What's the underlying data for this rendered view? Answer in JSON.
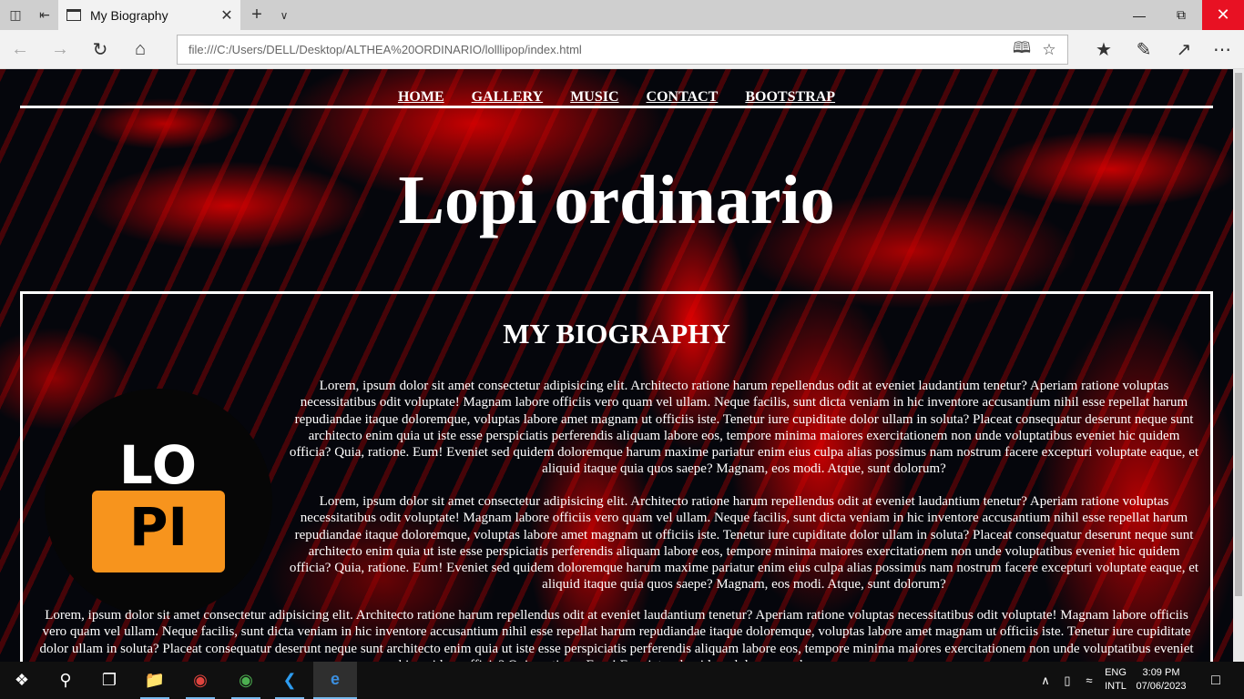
{
  "browser": {
    "tab_title": "My Biography",
    "url": "file:///C:/Users/DELL/Desktop/ALTHEA%20ORDINARIO/lolllipop/index.html"
  },
  "site": {
    "nav": [
      "HOME",
      "GALLERY",
      "MUSIC",
      "CONTACT",
      "BOOTSTRAP"
    ],
    "title": "Lopi ordinario",
    "bio_heading": "MY BIOGRAPHY",
    "logo_top": "LO",
    "logo_bottom": "PI",
    "paragraphs": [
      "Lorem, ipsum dolor sit amet consectetur adipisicing elit. Architecto ratione harum repellendus odit at eveniet laudantium tenetur? Aperiam ratione voluptas necessitatibus odit voluptate! Magnam labore officiis vero quam vel ullam. Neque facilis, sunt dicta veniam in hic inventore accusantium nihil esse repellat harum repudiandae itaque doloremque, voluptas labore amet magnam ut officiis iste. Tenetur iure cupiditate dolor ullam in soluta? Placeat consequatur deserunt neque sunt architecto enim quia ut iste esse perspiciatis perferendis aliquam labore eos, tempore minima maiores exercitationem non unde voluptatibus eveniet hic quidem officia? Quia, ratione. Eum! Eveniet sed quidem doloremque harum maxime pariatur enim eius culpa alias possimus nam nostrum facere excepturi voluptate eaque, et aliquid itaque quia quos saepe? Magnam, eos modi. Atque, sunt dolorum?",
      "Lorem, ipsum dolor sit amet consectetur adipisicing elit. Architecto ratione harum repellendus odit at eveniet laudantium tenetur? Aperiam ratione voluptas necessitatibus odit voluptate! Magnam labore officiis vero quam vel ullam. Neque facilis, sunt dicta veniam in hic inventore accusantium nihil esse repellat harum repudiandae itaque doloremque, voluptas labore amet magnam ut officiis iste. Tenetur iure cupiditate dolor ullam in soluta? Placeat consequatur deserunt neque sunt architecto enim quia ut iste esse perspiciatis perferendis aliquam labore eos, tempore minima maiores exercitationem non unde voluptatibus eveniet hic quidem officia? Quia, ratione. Eum! Eveniet sed quidem doloremque harum maxime pariatur enim eius culpa alias possimus nam nostrum facere excepturi voluptate eaque, et aliquid itaque quia quos saepe? Magnam, eos modi. Atque, sunt dolorum?",
      "Lorem, ipsum dolor sit amet consectetur adipisicing elit. Architecto ratione harum repellendus odit at eveniet laudantium tenetur? Aperiam ratione voluptas necessitatibus odit voluptate! Magnam labore officiis vero quam vel ullam. Neque facilis, sunt dicta veniam in hic inventore accusantium nihil esse repellat harum repudiandae itaque doloremque, voluptas labore amet magnam ut officiis iste. Tenetur iure cupiditate dolor ullam in soluta? Placeat consequatur deserunt neque sunt architecto enim quia ut iste esse perspiciatis perferendis aliquam labore eos, tempore minima maiores exercitationem non unde voluptatibus eveniet hic quidem officia? Quia, ratione. Eum! Eveniet sed quidem doloremque harum"
    ]
  },
  "taskbar": {
    "lang_1": "ENG",
    "lang_2": "INTL",
    "time": "3:09 PM",
    "date": "07/06/2023"
  },
  "colors": {
    "accent_red": "#e81123",
    "logo_orange": "#f7941d",
    "taskbar_highlight": "#76b9ed"
  }
}
